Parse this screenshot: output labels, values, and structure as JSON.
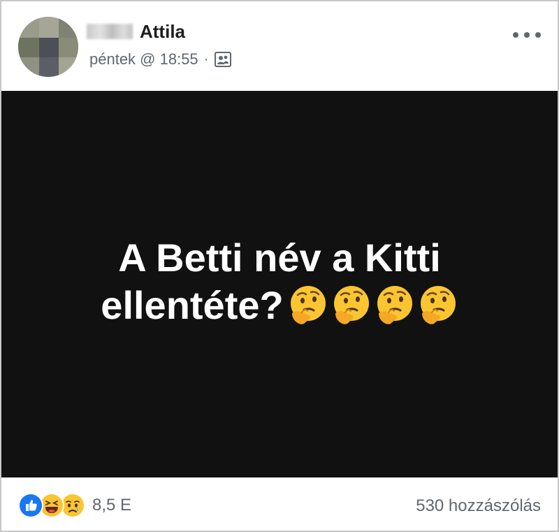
{
  "post": {
    "author_name": "Attila",
    "timestamp": "péntek @ 18:55",
    "separator": "·",
    "audience_icon": "friends-icon",
    "more_icon": "more-options-icon"
  },
  "content": {
    "line1": "A Betti név a Kitti",
    "line2": "ellentéte?",
    "emoji": "thinking-face-icon",
    "emoji_count": 4,
    "background_color": "#111111",
    "text_color": "#ffffff"
  },
  "footer": {
    "reactions": [
      "like-icon",
      "haha-icon",
      "sad-icon"
    ],
    "reaction_count": "8,5 E",
    "comments": "530 hozzászólás"
  },
  "colors": {
    "like": "#1877f2",
    "emoji_yellow": "#fbc531",
    "secondary_text": "#606770"
  }
}
